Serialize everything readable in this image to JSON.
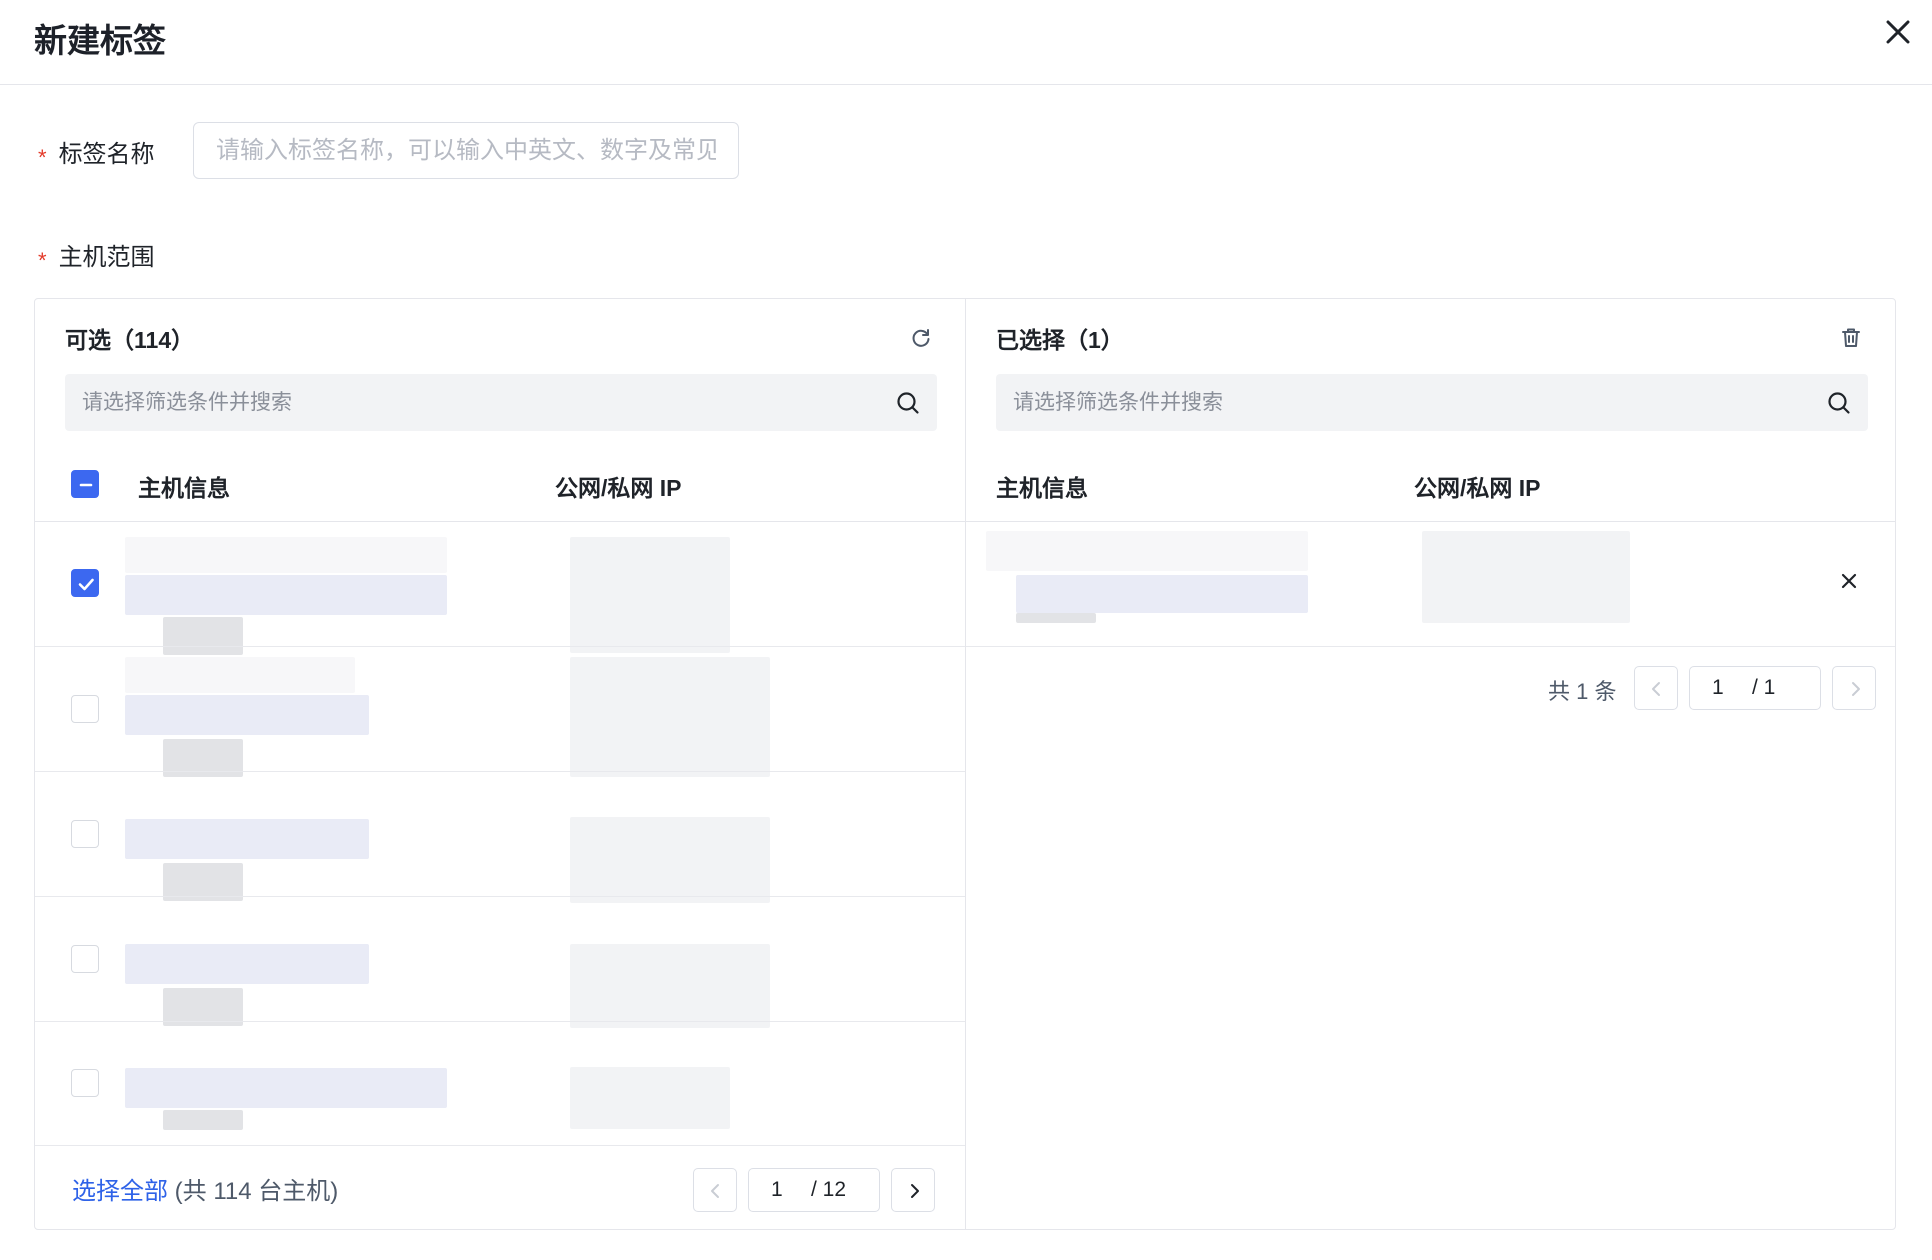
{
  "dialog": {
    "title": "新建标签",
    "close_icon": "close-icon"
  },
  "form": {
    "name_label": "标签名称",
    "name_placeholder": "请输入标签名称，可以输入中英文、数字及常见符号",
    "name_value": "",
    "scope_label": "主机范围",
    "required_mark": "*"
  },
  "left_panel": {
    "title": "可选（114）",
    "action_icon": "refresh-icon",
    "search_placeholder": "请选择筛选条件并搜索",
    "columns": [
      "主机信息",
      "公网/私网 IP"
    ],
    "header_checkbox_state": "indeterminate",
    "rows_checked": [
      true,
      false,
      false,
      false,
      false
    ],
    "select_all_label": "选择全部",
    "select_all_note": "(共 114 台主机)",
    "pagination": {
      "current": "1",
      "total": "/ 12"
    }
  },
  "right_panel": {
    "title": "已选择（1）",
    "action_icon": "trash-icon",
    "search_placeholder": "请选择筛选条件并搜索",
    "columns": [
      "主机信息",
      "公网/私网 IP"
    ],
    "remove_icon": "close-icon",
    "total_text": "共 1 条",
    "pagination": {
      "current": "1",
      "total": "/ 1"
    }
  },
  "colors": {
    "primary": "#3c68f0",
    "link": "#2e62e8",
    "required": "#e33b2a",
    "border": "#e5e6eb"
  }
}
